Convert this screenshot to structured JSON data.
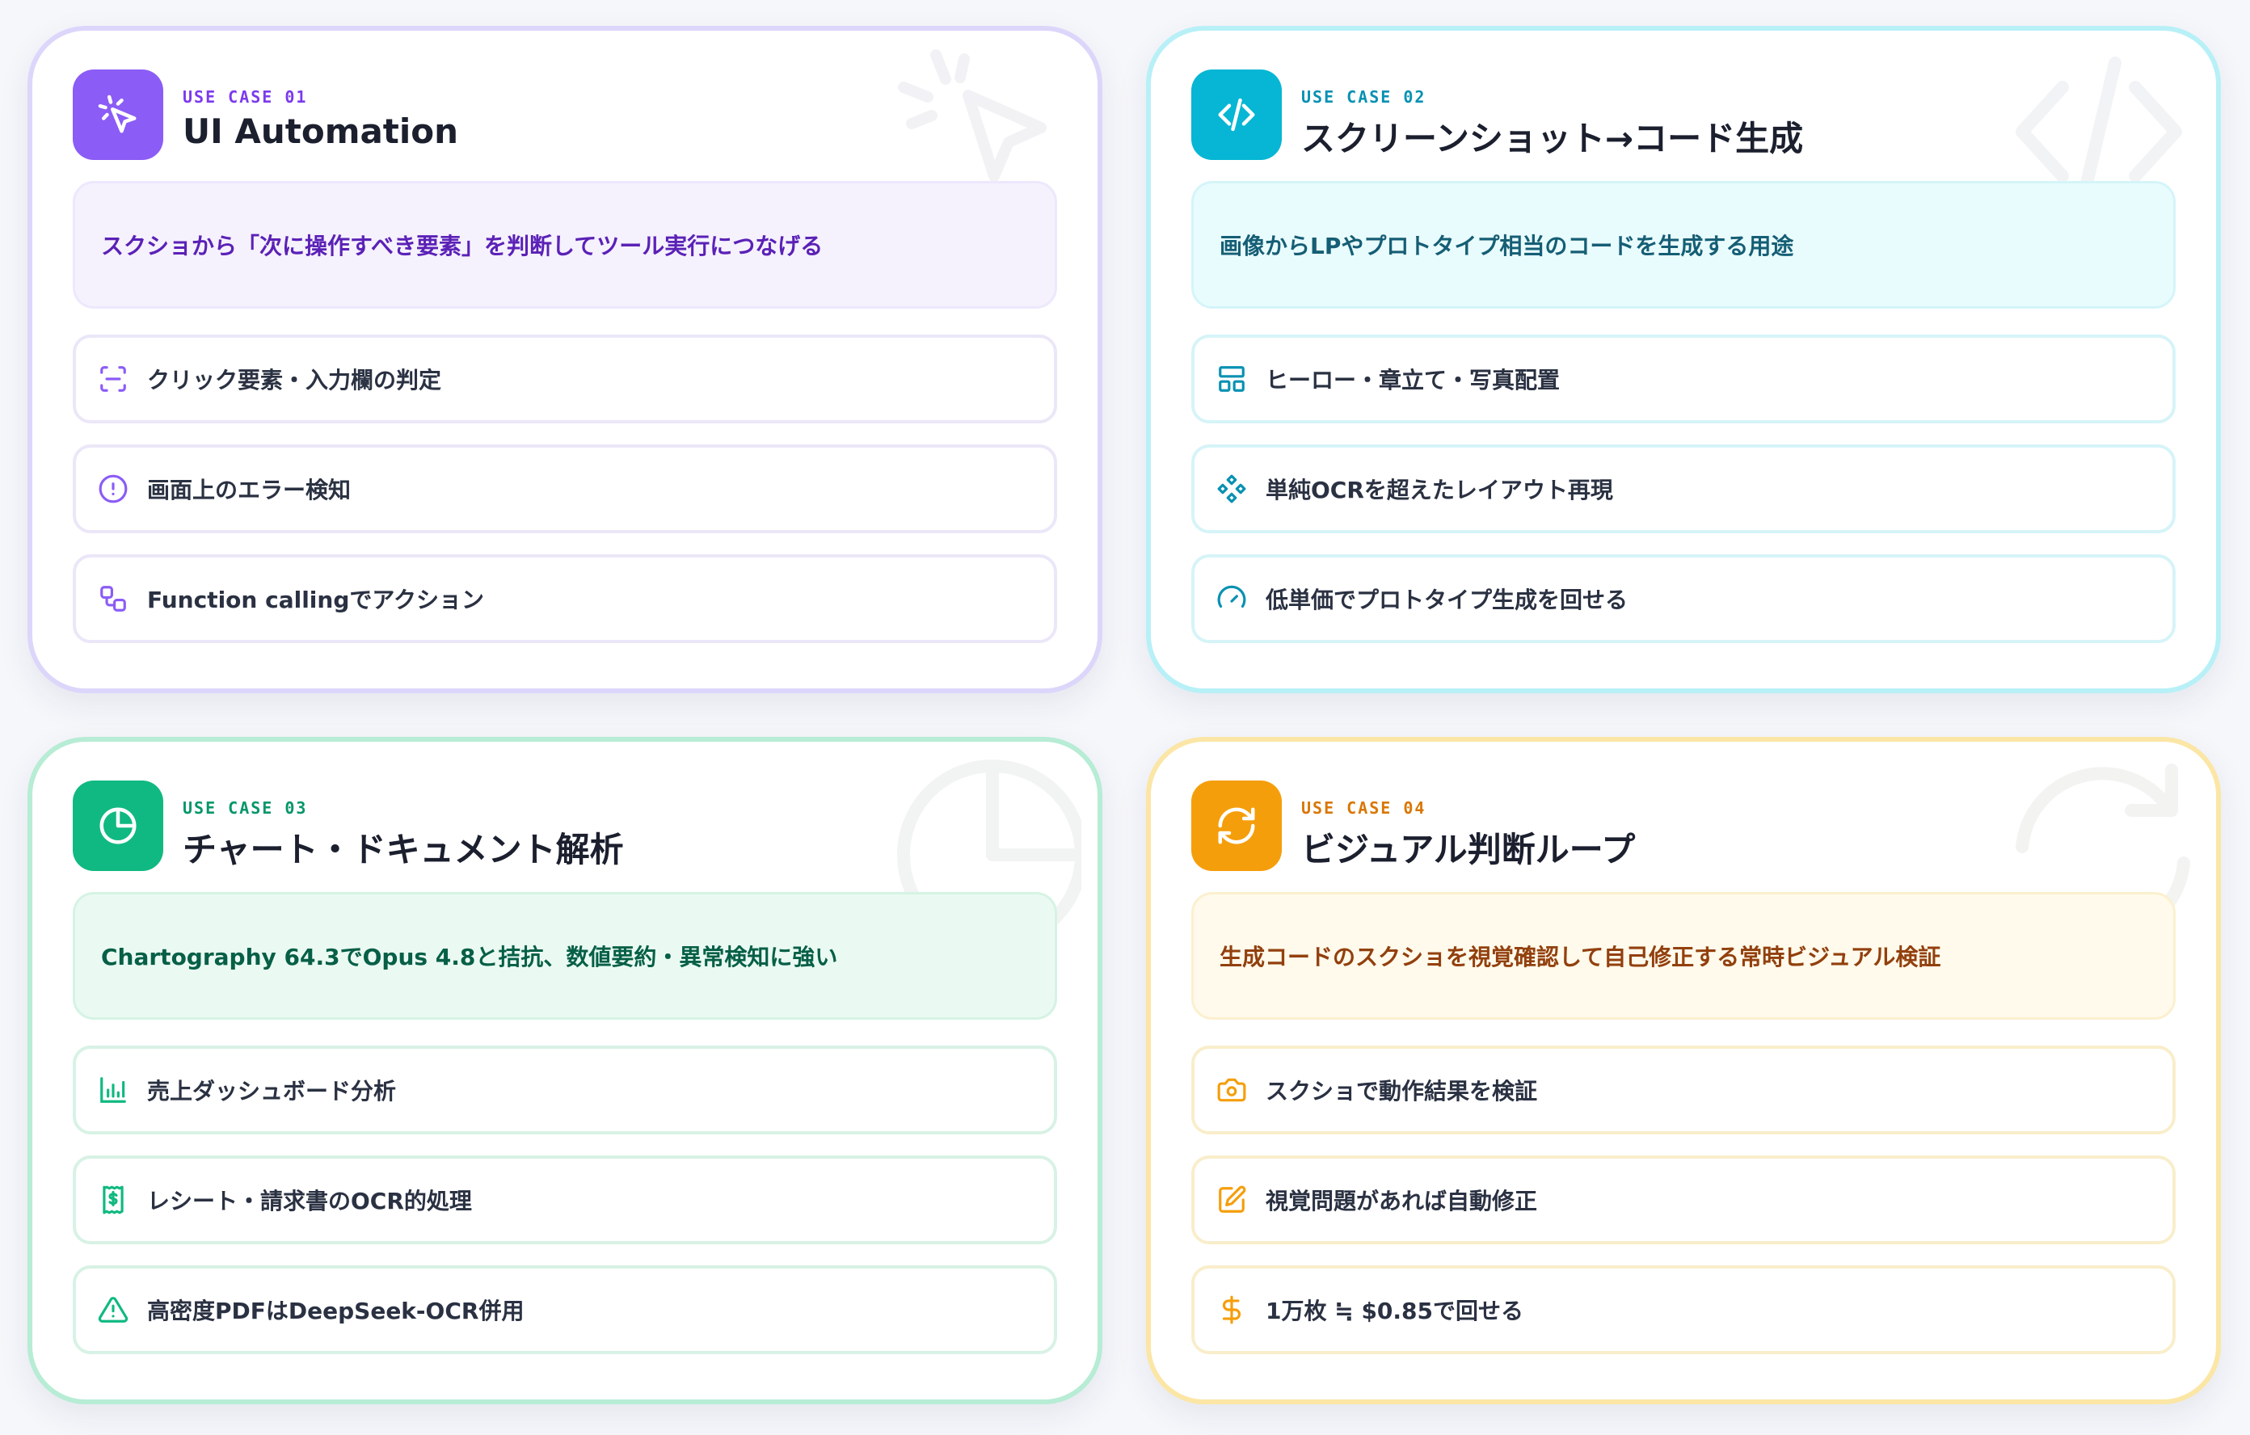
{
  "cards": [
    {
      "eyebrow": "USE CASE 01",
      "title": "UI Automation",
      "icon": "cursor-click-icon",
      "highlight": "スクショから「次に操作すべき要素」を判断してツール実行につなげる",
      "items": [
        {
          "icon": "scan-frame-icon",
          "label": "クリック要素・入力欄の判定"
        },
        {
          "icon": "alert-circle-icon",
          "label": "画面上のエラー検知"
        },
        {
          "icon": "workflow-icon",
          "label": "Function callingでアクション"
        }
      ]
    },
    {
      "eyebrow": "USE CASE 02",
      "title": "スクリーンショット→コード生成",
      "icon": "code-icon",
      "highlight": "画像からLPやプロトタイプ相当のコードを生成する用途",
      "items": [
        {
          "icon": "layout-icon",
          "label": "ヒーロー・章立て・写真配置"
        },
        {
          "icon": "component-icon",
          "label": "単純OCRを超えたレイアウト再現"
        },
        {
          "icon": "gauge-icon",
          "label": "低単価でプロトタイプ生成を回せる"
        }
      ]
    },
    {
      "eyebrow": "USE CASE 03",
      "title": "チャート・ドキュメント解析",
      "icon": "pie-chart-icon",
      "highlight": "Chartography 64.3でOpus 4.8と拮抗、数値要約・異常検知に強い",
      "items": [
        {
          "icon": "bar-chart-icon",
          "label": "売上ダッシュボード分析"
        },
        {
          "icon": "receipt-icon",
          "label": "レシート・請求書のOCR的処理"
        },
        {
          "icon": "warning-triangle-icon",
          "label": "高密度PDFはDeepSeek-OCR併用"
        }
      ]
    },
    {
      "eyebrow": "USE CASE 04",
      "title": "ビジュアル判断ループ",
      "icon": "refresh-icon",
      "highlight": "生成コードのスクショを視覚確認して自己修正する常時ビジュアル検証",
      "items": [
        {
          "icon": "camera-icon",
          "label": "スクショで動作結果を検証"
        },
        {
          "icon": "edit-icon",
          "label": "視覚問題があれば自動修正"
        },
        {
          "icon": "dollar-icon",
          "label": "1万枚 ≒ $0.85で回せる"
        }
      ]
    }
  ]
}
